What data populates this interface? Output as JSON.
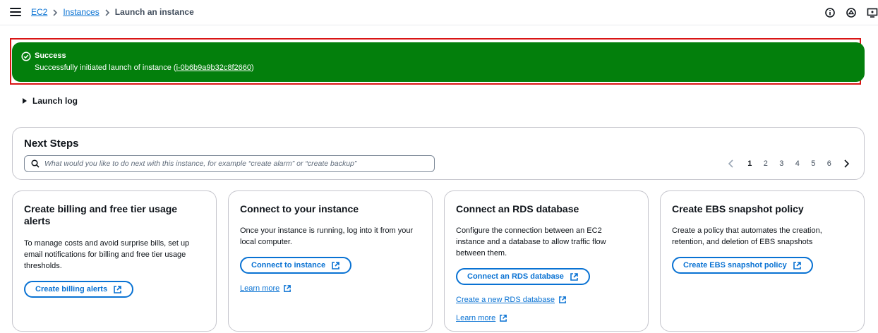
{
  "breadcrumb": {
    "items": [
      "EC2",
      "Instances"
    ],
    "current": "Launch an instance"
  },
  "top_icons": [
    "info-icon",
    "notifications-icon",
    "display-settings-icon"
  ],
  "flash": {
    "title": "Success",
    "message_prefix": "Successfully initiated launch of instance (",
    "instance_id": "i-0b6b9a9b32c8f2660",
    "message_suffix": ")",
    "color": "#037f0c"
  },
  "launch_log": {
    "label": "Launch log"
  },
  "next_steps": {
    "title": "Next Steps",
    "search_placeholder": "What would you like to do next with this instance, for example “create alarm” or “create backup”",
    "pages": [
      "1",
      "2",
      "3",
      "4",
      "5",
      "6"
    ],
    "active_page": "1"
  },
  "cards": [
    {
      "title": "Create billing and free tier usage alerts",
      "description": "To manage costs and avoid surprise bills, set up email notifications for billing and free tier usage thresholds.",
      "button": "Create billing alerts"
    },
    {
      "title": "Connect to your instance",
      "description": "Once your instance is running, log into it from your local computer.",
      "button": "Connect to instance",
      "link": "Learn more"
    },
    {
      "title": "Connect an RDS database",
      "description": "Configure the connection between an EC2 instance and a database to allow traffic flow between them.",
      "button": "Connect an RDS database",
      "link": "Create a new RDS database",
      "link2": "Learn more"
    },
    {
      "title": "Create EBS snapshot policy",
      "description": "Create a policy that automates the creation, retention, and deletion of EBS snapshots",
      "button": "Create EBS snapshot policy"
    }
  ],
  "colors": {
    "link": "#0972d3",
    "success": "#037f0c",
    "highlight": "#d91515"
  }
}
